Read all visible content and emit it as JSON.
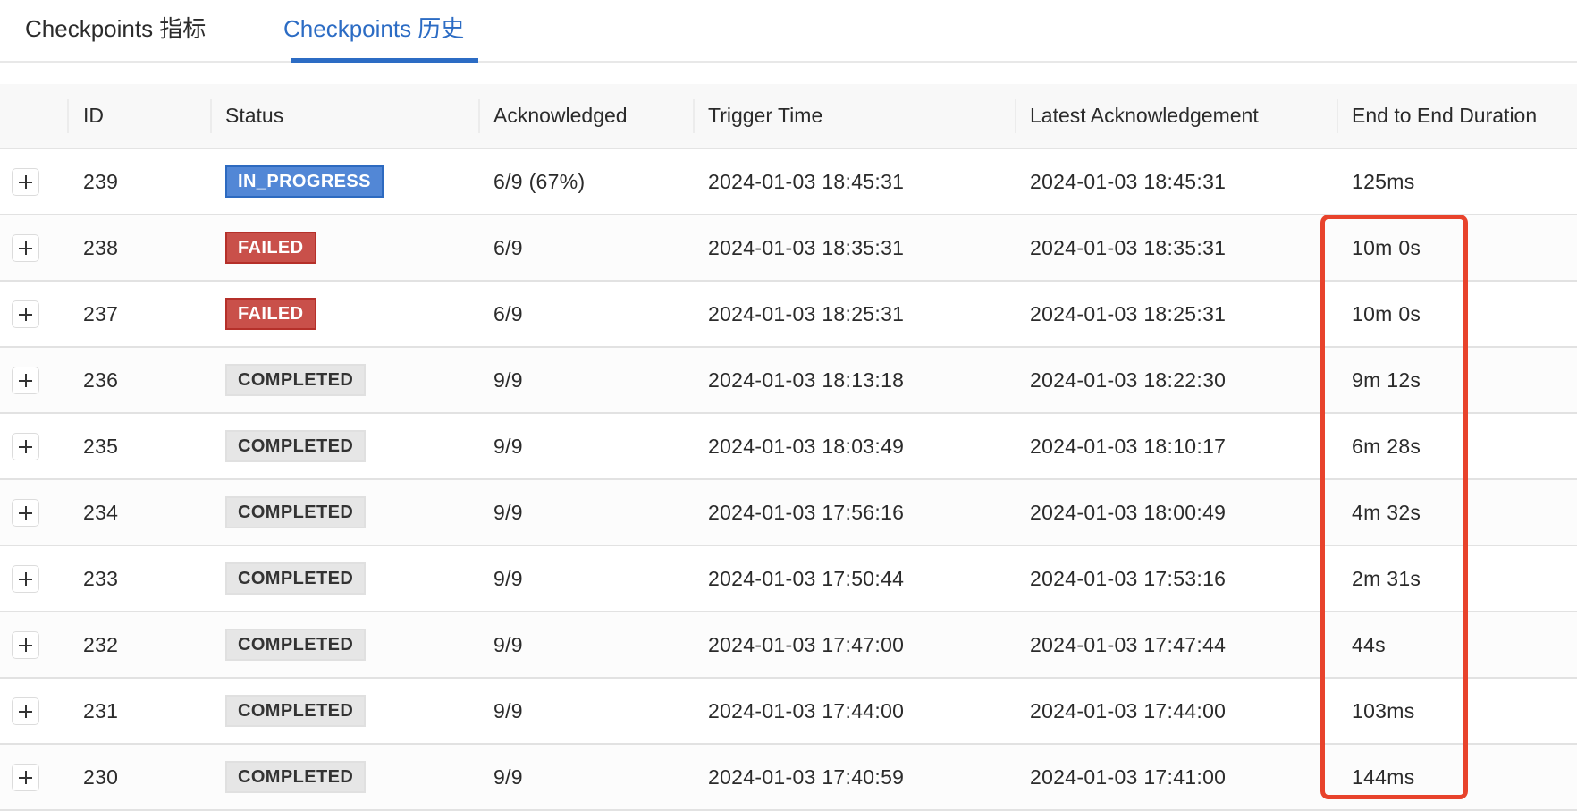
{
  "tabs": [
    {
      "label": "Checkpoints 指标",
      "active": false
    },
    {
      "label": "Checkpoints 历史",
      "active": true
    }
  ],
  "colors": {
    "accent": "#2c6cc4",
    "in_progress": "#5287d6",
    "failed": "#c9504a",
    "completed": "#e6e6e6",
    "highlight_box": "#e8432c"
  },
  "table": {
    "columns": [
      "ID",
      "Status",
      "Acknowledged",
      "Trigger Time",
      "Latest Acknowledgement",
      "End to End Duration"
    ],
    "expand_icon": "plus-icon",
    "rows": [
      {
        "id": "239",
        "status": "IN_PROGRESS",
        "acknowledged": "6/9 (67%)",
        "trigger_time": "2024-01-03 18:45:31",
        "latest_ack": "2024-01-03 18:45:31",
        "duration": "125ms"
      },
      {
        "id": "238",
        "status": "FAILED",
        "acknowledged": "6/9",
        "trigger_time": "2024-01-03 18:35:31",
        "latest_ack": "2024-01-03 18:35:31",
        "duration": "10m 0s"
      },
      {
        "id": "237",
        "status": "FAILED",
        "acknowledged": "6/9",
        "trigger_time": "2024-01-03 18:25:31",
        "latest_ack": "2024-01-03 18:25:31",
        "duration": "10m 0s"
      },
      {
        "id": "236",
        "status": "COMPLETED",
        "acknowledged": "9/9",
        "trigger_time": "2024-01-03 18:13:18",
        "latest_ack": "2024-01-03 18:22:30",
        "duration": "9m 12s"
      },
      {
        "id": "235",
        "status": "COMPLETED",
        "acknowledged": "9/9",
        "trigger_time": "2024-01-03 18:03:49",
        "latest_ack": "2024-01-03 18:10:17",
        "duration": "6m 28s"
      },
      {
        "id": "234",
        "status": "COMPLETED",
        "acknowledged": "9/9",
        "trigger_time": "2024-01-03 17:56:16",
        "latest_ack": "2024-01-03 18:00:49",
        "duration": "4m 32s"
      },
      {
        "id": "233",
        "status": "COMPLETED",
        "acknowledged": "9/9",
        "trigger_time": "2024-01-03 17:50:44",
        "latest_ack": "2024-01-03 17:53:16",
        "duration": "2m 31s"
      },
      {
        "id": "232",
        "status": "COMPLETED",
        "acknowledged": "9/9",
        "trigger_time": "2024-01-03 17:47:00",
        "latest_ack": "2024-01-03 17:47:44",
        "duration": "44s"
      },
      {
        "id": "231",
        "status": "COMPLETED",
        "acknowledged": "9/9",
        "trigger_time": "2024-01-03 17:44:00",
        "latest_ack": "2024-01-03 17:44:00",
        "duration": "103ms"
      },
      {
        "id": "230",
        "status": "COMPLETED",
        "acknowledged": "9/9",
        "trigger_time": "2024-01-03 17:40:59",
        "latest_ack": "2024-01-03 17:41:00",
        "duration": "144ms"
      }
    ]
  }
}
